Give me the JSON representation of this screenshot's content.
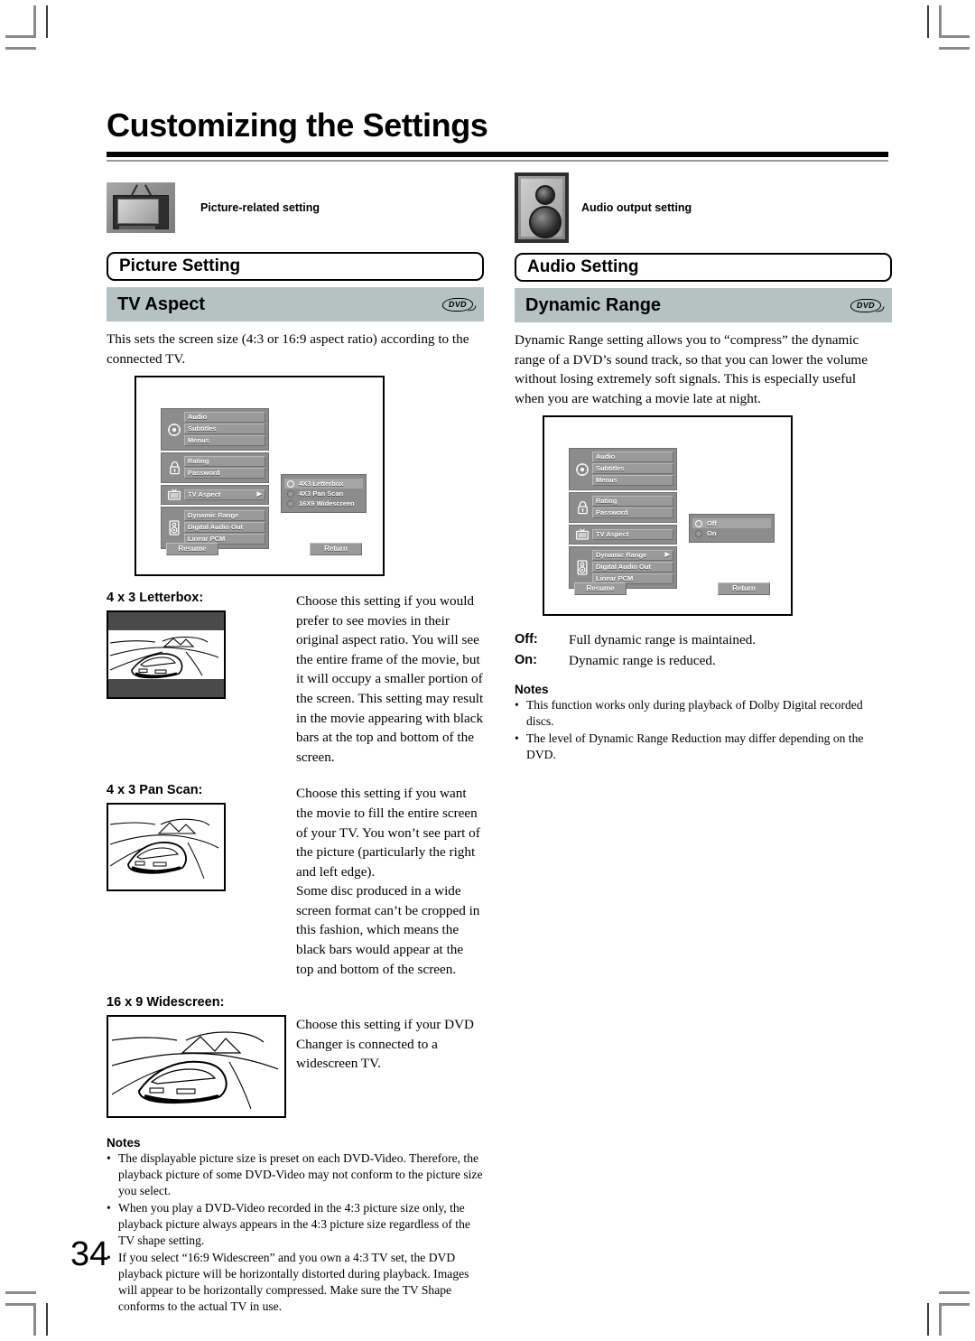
{
  "page": {
    "title": "Customizing the Settings",
    "number": "34"
  },
  "left_column": {
    "badge": {
      "icon": "tv-icon",
      "caption": "Picture-related setting"
    },
    "section_box": {
      "label": "Picture Setting"
    },
    "sub_header": {
      "label": "TV Aspect",
      "disc_badge": "DVD"
    },
    "intro": "This sets the screen size (4:3 or 16:9 aspect ratio) according to the connected TV.",
    "osd": {
      "groups": [
        {
          "icon": "compass-icon",
          "items": [
            {
              "label": "Audio",
              "arrow": false
            },
            {
              "label": "Subtitles",
              "arrow": false
            },
            {
              "label": "Menus",
              "arrow": false
            }
          ]
        },
        {
          "icon": "lock-icon",
          "items": [
            {
              "label": "Rating",
              "arrow": false
            },
            {
              "label": "Password",
              "arrow": false
            }
          ]
        },
        {
          "icon": "tv-icon",
          "items": [
            {
              "label": "TV Aspect",
              "arrow": true
            }
          ]
        },
        {
          "icon": "speaker-icon",
          "items": [
            {
              "label": "Dynamic Range",
              "arrow": false
            },
            {
              "label": "Digital Audio Out",
              "arrow": false
            },
            {
              "label": "Linear PCM",
              "arrow": false
            }
          ]
        }
      ],
      "options": [
        {
          "label": "4X3 Letterbox",
          "selected": true
        },
        {
          "label": "4X3 Pan Scan",
          "selected": false
        },
        {
          "label": "16X9 Widescreen",
          "selected": false
        }
      ],
      "buttons": {
        "resume": "Resume",
        "return": "Return"
      }
    },
    "entries": [
      {
        "label": "4 x 3 Letterbox:",
        "picture": "car-letterbox-illustration",
        "description": "Choose this setting if you would prefer to see movies in their original aspect ratio. You will see the entire frame of the movie, but it will occupy a smaller portion of the screen. This setting may result in the movie appearing with black bars at the top and bottom of the screen."
      },
      {
        "label": "4 x 3 Pan Scan:",
        "picture": "car-panscan-illustration",
        "description": "Choose this setting if you want the movie to fill the entire screen of your TV. You won’t see part of the picture (particularly the right and left edge).\nSome disc produced in a wide screen format can’t be cropped in this fashion, which means the black bars would appear at the top and bottom of the screen."
      },
      {
        "label": "16 x 9 Widescreen:",
        "picture": "car-widescreen-illustration",
        "description": "Choose this setting if your DVD Changer is connected to a widescreen TV."
      }
    ],
    "notes": {
      "heading": "Notes",
      "items": [
        "The displayable picture size is preset on each DVD-Video. Therefore, the playback picture of some DVD-Video may not conform to the picture size you select.",
        "When you play a DVD-Video recorded in the 4:3 picture size only, the playback picture always appears in the 4:3 picture size regardless of the TV shape setting.",
        "If you select “16:9 Widescreen” and you own a 4:3 TV set, the DVD playback picture will be horizontally distorted during playback. Images will appear to be horizontally compressed. Make sure the TV Shape conforms to the actual TV in use."
      ]
    }
  },
  "right_column": {
    "badge": {
      "icon": "speaker-icon",
      "caption": "Audio output setting"
    },
    "section_box": {
      "label": "Audio Setting"
    },
    "sub_header": {
      "label": "Dynamic Range",
      "disc_badge": "DVD"
    },
    "intro": "Dynamic Range setting allows you to “compress” the dynamic range of a DVD’s sound track, so that you can lower the volume without losing extremely soft signals. This is especially useful when you are watching a movie late at night.",
    "osd": {
      "groups": [
        {
          "icon": "compass-icon",
          "items": [
            {
              "label": "Audio",
              "arrow": false
            },
            {
              "label": "Subtitles",
              "arrow": false
            },
            {
              "label": "Menus",
              "arrow": false
            }
          ]
        },
        {
          "icon": "lock-icon",
          "items": [
            {
              "label": "Rating",
              "arrow": false
            },
            {
              "label": "Password",
              "arrow": false
            }
          ]
        },
        {
          "icon": "tv-icon",
          "items": [
            {
              "label": "TV Aspect",
              "arrow": false
            }
          ]
        },
        {
          "icon": "speaker-icon",
          "items": [
            {
              "label": "Dynamic Range",
              "arrow": true
            },
            {
              "label": "Digital Audio Out",
              "arrow": false
            },
            {
              "label": "Linear PCM",
              "arrow": false
            }
          ]
        }
      ],
      "options": [
        {
          "label": "Off",
          "selected": true
        },
        {
          "label": "On",
          "selected": false
        }
      ],
      "buttons": {
        "resume": "Resume",
        "return": "Return"
      }
    },
    "values": [
      {
        "key": "Off:",
        "text": "Full dynamic range is maintained."
      },
      {
        "key": "On:",
        "text": "Dynamic range is reduced."
      }
    ],
    "notes": {
      "heading": "Notes",
      "items": [
        "This function works only during playback of Dolby Digital recorded discs.",
        "The level of Dynamic Range Reduction may differ depending on the DVD."
      ]
    }
  }
}
